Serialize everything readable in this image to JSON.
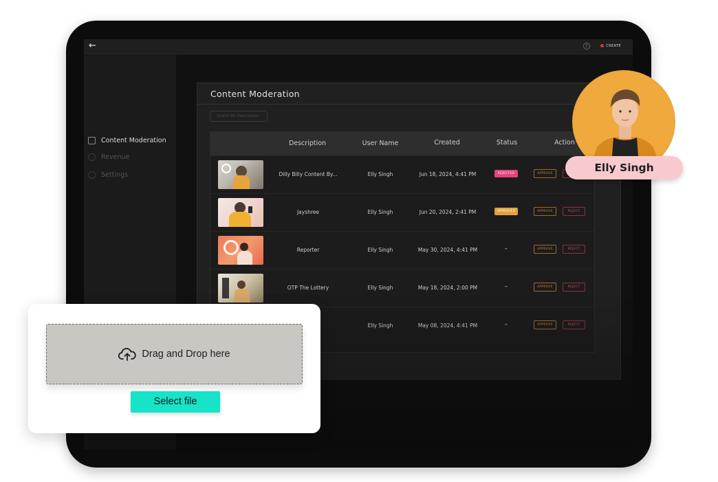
{
  "app": {
    "create_label": "CREATE"
  },
  "sidebar": {
    "items": [
      {
        "label": "Content Moderation",
        "icon": "grid-icon"
      },
      {
        "label": "Revenue",
        "icon": "coin-icon"
      },
      {
        "label": "Settings",
        "icon": "gear-icon"
      }
    ]
  },
  "panel": {
    "title": "Content  Moderation",
    "search_placeholder": "Search By Description"
  },
  "table": {
    "headers": [
      "Description",
      "User Name",
      "Created",
      "Status",
      "Action"
    ],
    "rows": [
      {
        "description": "Dilly Billy Content By...",
        "user": "Elly Singh",
        "created": "Jun 18, 2024, 4:41 PM",
        "status": "REJECTED",
        "approve": "APPROVE",
        "reject": "REJECT"
      },
      {
        "description": "Jayshree",
        "user": "Elly Singh",
        "created": "Jun 20, 2024, 2:41 PM",
        "status": "APPROVED",
        "approve": "APPROVE",
        "reject": "REJECT"
      },
      {
        "description": "Reporter",
        "user": "Elly Singh",
        "created": "May 30, 2024, 4:41 PM",
        "status": "–",
        "approve": "APPROVE",
        "reject": "REJECT"
      },
      {
        "description": "OTP The Lottery",
        "user": "Elly Singh",
        "created": "May 18, 2024, 2:00 PM",
        "status": "–",
        "approve": "APPROVE",
        "reject": "REJECT"
      },
      {
        "description": "",
        "user": "Elly Singh",
        "created": "May 08, 2024, 4:41 PM",
        "status": "–",
        "approve": "APPROVE",
        "reject": "REJECT"
      }
    ]
  },
  "profile": {
    "name": "Elly Singh"
  },
  "upload": {
    "drop_text": "Drag and Drop here",
    "button_label": "Select file"
  },
  "colors": {
    "accent_teal": "#16e3c7",
    "chip_pink": "#f8c9cd",
    "status_rejected": "#e2457d",
    "status_approved": "#e3a13c",
    "avatar_bg": "#f0a93c"
  }
}
